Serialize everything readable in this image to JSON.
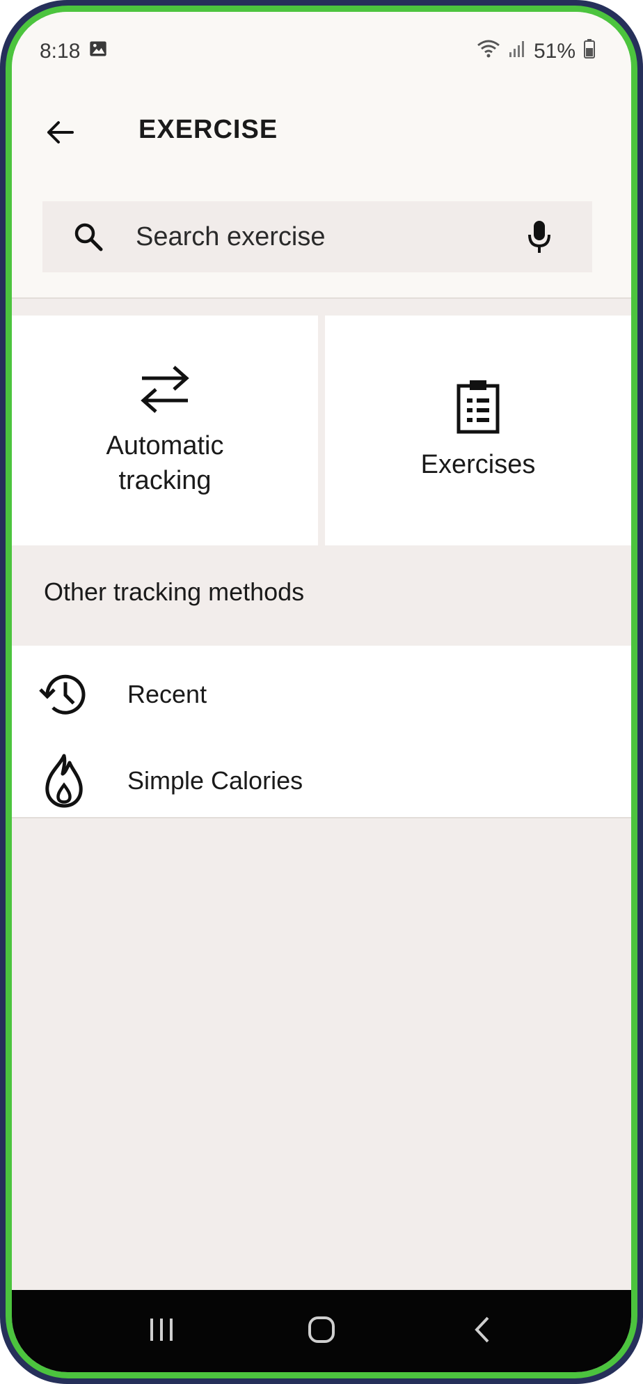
{
  "status_bar": {
    "time": "8:18",
    "battery": "51%",
    "icons": [
      "gallery-icon",
      "wifi-icon",
      "signal-icon",
      "battery-icon"
    ]
  },
  "header": {
    "title": "EXERCISE",
    "back_icon": "arrow-left-icon"
  },
  "search": {
    "placeholder": "Search exercise",
    "value": "",
    "icons": [
      "search-icon",
      "microphone-icon"
    ]
  },
  "cards": [
    {
      "label": "Automatic tracking",
      "icon": "swap-arrows-icon"
    },
    {
      "label": "Exercises",
      "icon": "clipboard-icon"
    }
  ],
  "other_section": {
    "title": "Other tracking methods",
    "items": [
      {
        "label": "Recent",
        "icon": "history-icon"
      },
      {
        "label": "Simple Calories",
        "icon": "flame-icon"
      }
    ]
  },
  "nav_bar": {
    "buttons": [
      "recents-icon",
      "home-icon",
      "back-icon"
    ]
  },
  "colors": {
    "header_bg": "#faf8f5",
    "page_bg": "#f2edeb",
    "card_bg": "#ffffff",
    "search_bg": "#f1ecea",
    "frame_outer": "#26305a",
    "frame_inner": "#4cc43e"
  }
}
